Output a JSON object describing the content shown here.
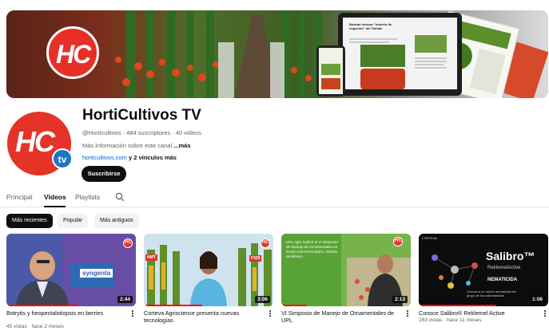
{
  "channel": {
    "name": "HortiCultivos TV",
    "handle": "@Horticultivos",
    "subscribers": "484 suscriptores",
    "videos_count": "40 videos",
    "meta_separator": " · ",
    "description": "Más información sobre este canal",
    "description_more": " ...más",
    "link_site": "horticultivos.com",
    "link_more": " y 2 vínculos más",
    "subscribe_label": "Suscribirse",
    "logo_text": "HC",
    "logo_tv": "tv"
  },
  "banner": {
    "laptop_headline": "Buscan innovar \"modelo de negocios\" del Tomate"
  },
  "tabs": [
    {
      "label": "Principal",
      "active": false
    },
    {
      "label": "Videos",
      "active": true
    },
    {
      "label": "Playlists",
      "active": false
    }
  ],
  "chips": [
    {
      "label": "Más recientes",
      "active": true
    },
    {
      "label": "Popular",
      "active": false
    },
    {
      "label": "Más antiguos",
      "active": false
    }
  ],
  "videos": [
    {
      "title": "Botrytis y heopestalotiopsis en berries",
      "views": "45 vistas",
      "age": "hace 2 meses",
      "duration": "2:44",
      "thumb_text": "syngenta",
      "progress": 0.55
    },
    {
      "title": "Corteva Agriscience presenta nuevas tecnologías",
      "views": "",
      "age": "",
      "duration": "3:06",
      "thumb_text": "F329",
      "thumb_text2": "NMT",
      "progress": 0.45
    },
    {
      "title": "VI Simposio de Manejo de Ornamentales de UPL",
      "views": "",
      "age": "",
      "duration": "2:13",
      "thumb_text": "UPL Agro realizó el VI Simposio de Manejo de Ornamentales en Exotic Ana Invernadero, Estado de México",
      "progress": 0.2
    },
    {
      "title": "Conoce Salibro® Reklemel Active",
      "views": "283 vistas",
      "age": "hace 11 meses",
      "duration": "1:06",
      "thumb_text": "Salibro™",
      "thumb_text2": "ReklemelActive",
      "thumb_text3": "NEMATICIDA",
      "thumb_text4": "Conoce a un nuevo nematicida del grupo de los sulfonamidas.",
      "thumb_brand": "CORTEVA",
      "progress": 0.6
    }
  ],
  "meta_dot": " · ",
  "colors": {
    "brand_red": "#e53327",
    "tv_blue": "#1d76c2",
    "link_blue": "#065fd4",
    "progress_red": "#ff0000"
  },
  "icons": [
    "search-icon",
    "more-vertical-icon"
  ]
}
